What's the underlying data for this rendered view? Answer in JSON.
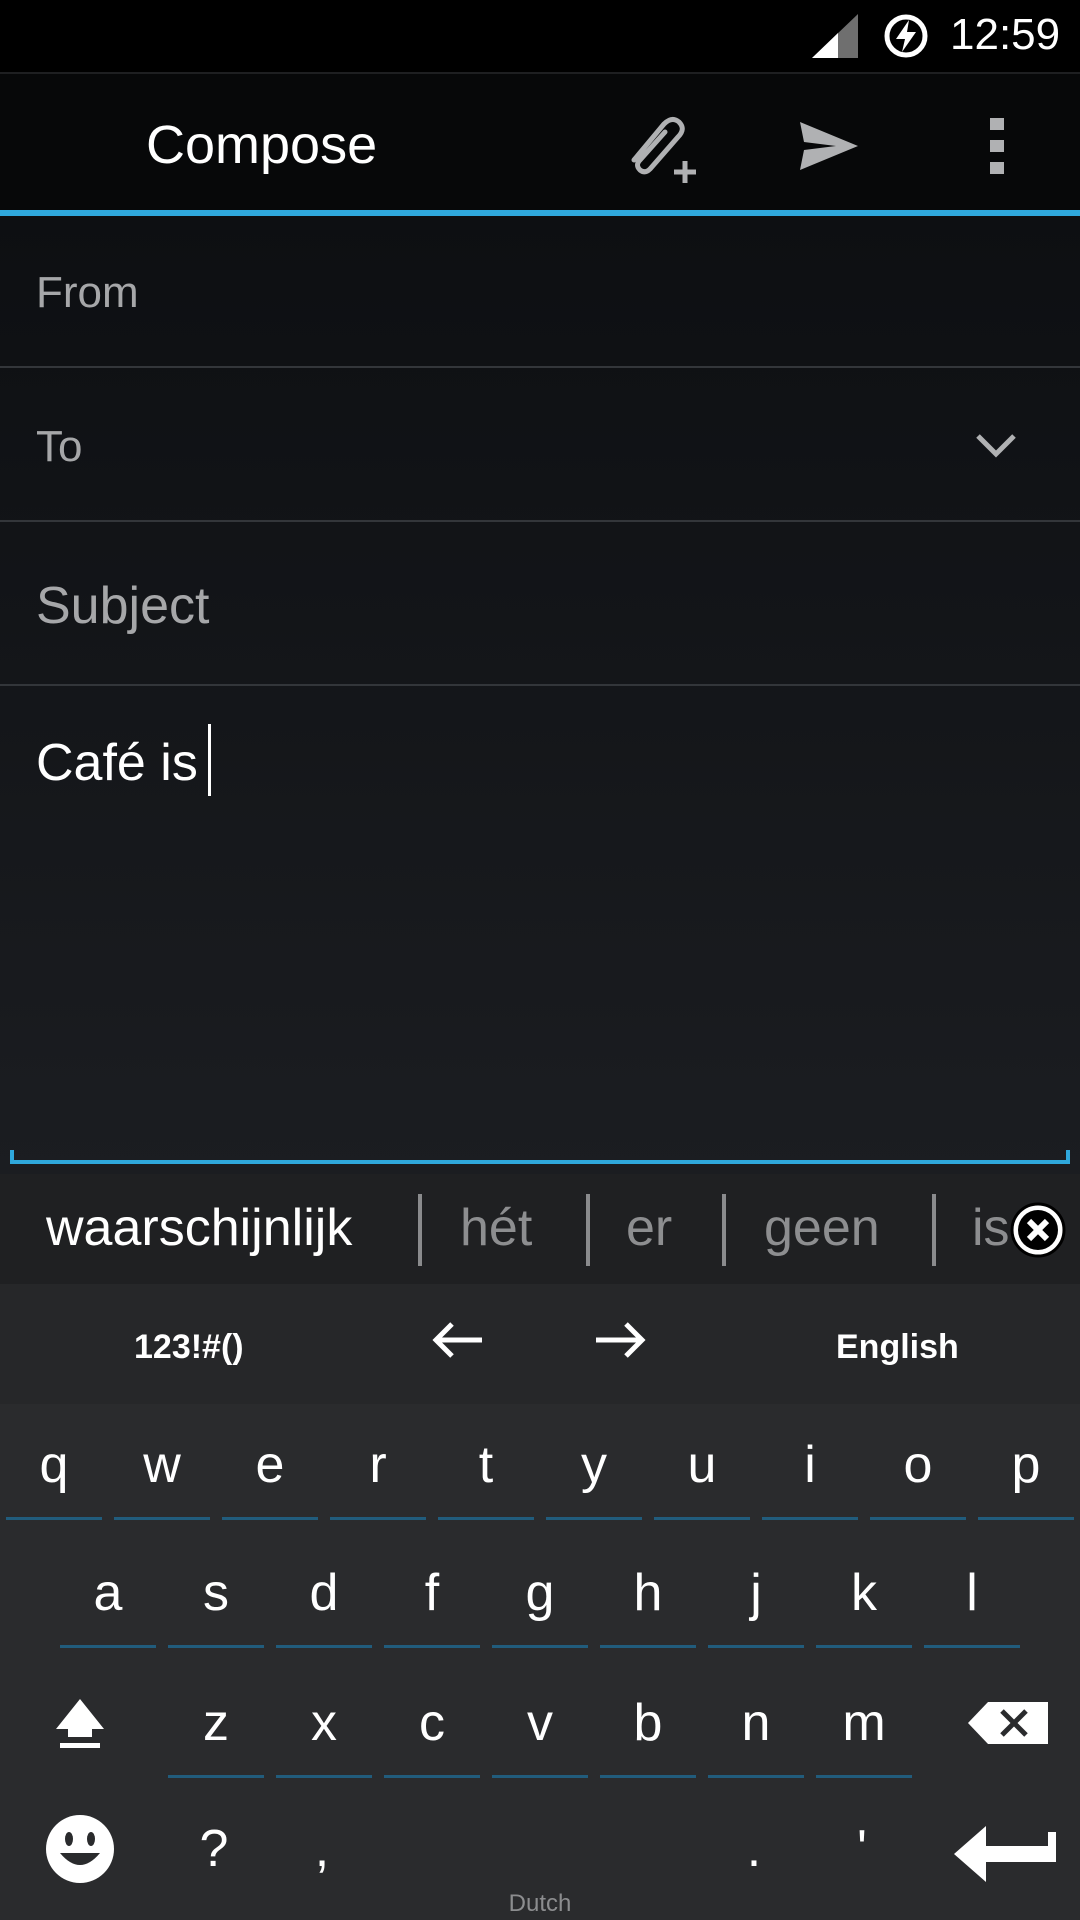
{
  "status_bar": {
    "time": "12:59",
    "icons": [
      "signal-icon",
      "battery-charging-icon"
    ]
  },
  "action_bar": {
    "title": "Compose",
    "actions": [
      "attach-icon",
      "send-icon",
      "overflow-menu-icon"
    ]
  },
  "form": {
    "from_label": "From",
    "to_label": "To",
    "subject_placeholder": "Subject",
    "body_text": "Café is"
  },
  "keyboard": {
    "suggestions": [
      "waarschijnlijk",
      "hét",
      "er",
      "geen",
      "is"
    ],
    "tools": {
      "symbols_label": "123!#()",
      "language_label": "English"
    },
    "rows": [
      [
        "q",
        "w",
        "e",
        "r",
        "t",
        "y",
        "u",
        "i",
        "o",
        "p"
      ],
      [
        "a",
        "s",
        "d",
        "f",
        "g",
        "h",
        "j",
        "k",
        "l"
      ],
      [
        "z",
        "x",
        "c",
        "v",
        "b",
        "n",
        "m"
      ]
    ],
    "bottom_row": {
      "question": "?",
      "comma": ",",
      "space_label": "Dutch",
      "period": ".",
      "apostrophe": "'"
    }
  },
  "colors": {
    "accent": "#2fa8dc",
    "key_underline": "#215c7c"
  }
}
